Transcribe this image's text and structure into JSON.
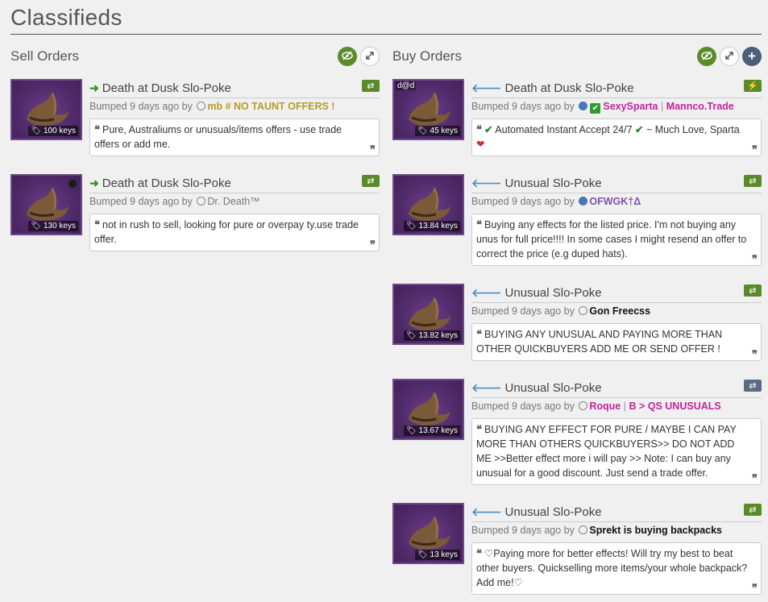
{
  "page": {
    "title": "Classifieds"
  },
  "colors": {
    "accent_green": "#5b8a2a",
    "buy_arrow": "#4a8ec4",
    "sell_arrow": "#3a8f2a",
    "item_bg": "#4f2a69"
  },
  "sell": {
    "title": "Sell Orders",
    "listings": [
      {
        "name": "Death at Dusk Slo-Poke",
        "price": "100 keys",
        "bumped": "Bumped 9 days ago by",
        "user": "mb # NO TAUNT OFFERS !",
        "comment": "Pure, Australiums or unusuals/items offers - use trade offers or add me.",
        "badge_icon": "exchange-icon"
      },
      {
        "name": "Death at Dusk Slo-Poke",
        "price": "130 keys",
        "bumped": "Bumped 9 days ago by",
        "user": "Dr. Death™",
        "comment": "not in rush to sell, looking for pure or overpay ty.use trade offer.",
        "badge_icon": "exchange-icon"
      }
    ]
  },
  "buy": {
    "title": "Buy Orders",
    "listings": [
      {
        "name": "Death at Dusk Slo-Poke",
        "price": "45 keys",
        "thumb_note": "d@d",
        "bumped": "Bumped 9 days ago by",
        "user": "SexySparta",
        "user_sep": "|",
        "user_extra": "Mannco.Trade",
        "comment_pre": "Automated Instant Accept 24/7",
        "comment_mid": "~ Much Love, Sparta",
        "badge_icon": "lightning-icon"
      },
      {
        "name": "Unusual Slo-Poke",
        "price": "13.84 keys",
        "bumped": "Bumped 9 days ago by",
        "user": "OFWGK†Δ",
        "comment": "Buying any effects for the listed price. I'm not buying any unus for full price!!!! In some cases I might resend an offer to correct the price (e.g duped hats).",
        "badge_icon": "exchange-icon"
      },
      {
        "name": "Unusual Slo-Poke",
        "price": "13.82 keys",
        "bumped": "Bumped 9 days ago by",
        "user": "Gon Freecss",
        "comment": "BUYING ANY UNUSUAL AND PAYING MORE THAN OTHER QUICKBUYERS ADD ME OR SEND OFFER !",
        "badge_icon": "exchange-icon"
      },
      {
        "name": "Unusual Slo-Poke",
        "price": "13.67 keys",
        "bumped": "Bumped 9 days ago by",
        "user": "Roque",
        "user_sep": "|",
        "user_extra": "B > QS UNUSUALS",
        "comment": "BUYING ANY EFFECT FOR PURE / MAYBE I CAN PAY MORE THAN OTHERS QUICKBUYERS>> DO NOT ADD ME >>Better effect more i will pay >> Note: I can buy any unusual for a good discount. Just send a trade offer.",
        "badge_icon": "exchange-icon"
      },
      {
        "name": "Unusual Slo-Poke",
        "price": "13 keys",
        "bumped": "Bumped 9 days ago by",
        "user": "Sprekt is buying backpacks",
        "comment": "♡Paying more for better effects! Will try my best to beat other buyers. Quickselling more items/your whole backpack? Add me!♡",
        "badge_icon": "exchange-icon"
      }
    ]
  }
}
